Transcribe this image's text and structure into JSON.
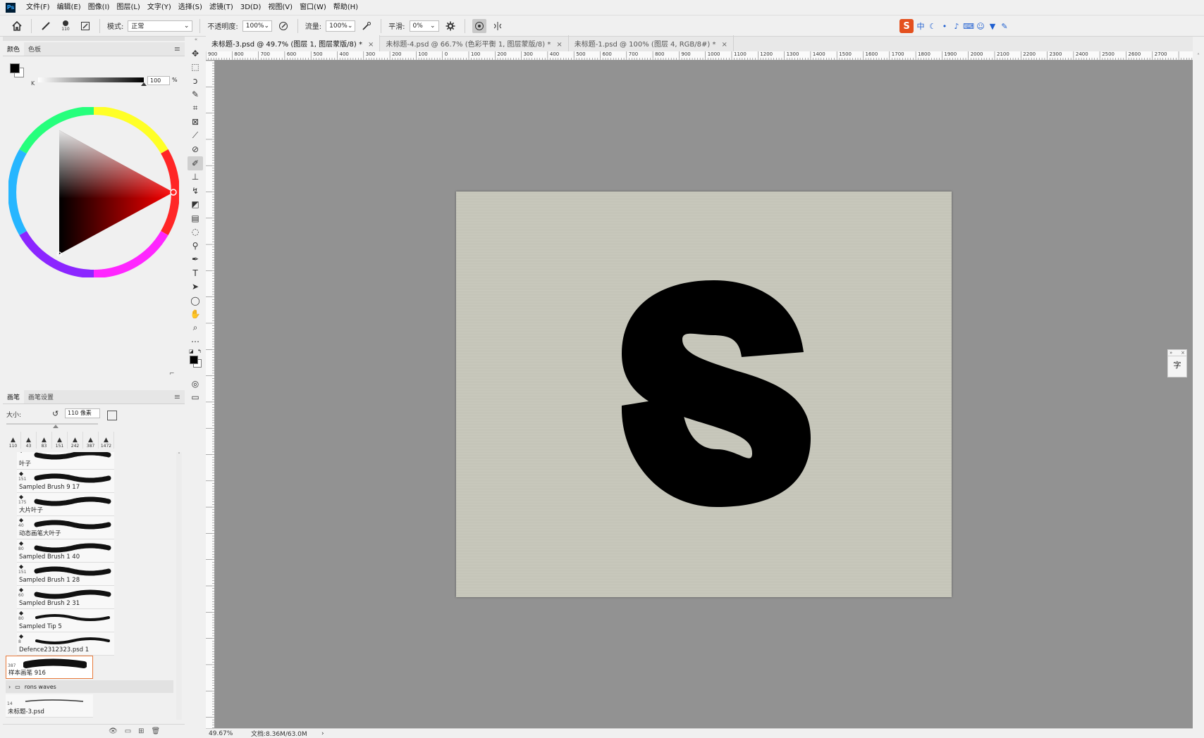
{
  "app": {
    "logo": "Ps"
  },
  "menu": [
    "文件(F)",
    "编辑(E)",
    "图像(I)",
    "图层(L)",
    "文字(Y)",
    "选择(S)",
    "滤镜(T)",
    "3D(D)",
    "视图(V)",
    "窗口(W)",
    "帮助(H)"
  ],
  "options": {
    "brush_size": "110",
    "mode_label": "模式:",
    "mode_value": "正常",
    "opacity_label": "不透明度:",
    "opacity_value": "100%",
    "flow_label": "流量:",
    "flow_value": "100%",
    "smooth_label": "平滑:",
    "smooth_value": "0%"
  },
  "ime": {
    "logo": "S",
    "lang": "中"
  },
  "color_panel": {
    "tabs": [
      "颜色",
      "色板"
    ],
    "slider_label": "K",
    "slider_value": "100",
    "unit": "%"
  },
  "brush_panel": {
    "tabs": [
      "画笔",
      "画笔设置"
    ],
    "size_label": "大小:",
    "size_value": "110 像素",
    "presets": [
      "110",
      "43",
      "83",
      "151",
      "242",
      "387",
      "1472"
    ],
    "brushes": [
      {
        "size": "",
        "name": "叶子"
      },
      {
        "size": "151",
        "name": "Sampled Brush 9 17"
      },
      {
        "size": "175",
        "name": "大片叶子"
      },
      {
        "size": "40",
        "name": "动态画笔大叶子"
      },
      {
        "size": "80",
        "name": "Sampled Brush 1 40"
      },
      {
        "size": "151",
        "name": "Sampled Brush 1 28"
      },
      {
        "size": "60",
        "name": "Sampled Brush 2 31"
      },
      {
        "size": "80",
        "name": "Sampled Tip 5"
      },
      {
        "size": "8",
        "name": "Defence2312323.psd 1"
      }
    ],
    "selected_brush": {
      "size": "387",
      "name": "样本画笔 916"
    },
    "group": "rons waves",
    "last_brush": {
      "size": "14",
      "name": "未标题-3.psd"
    }
  },
  "doc_tabs": [
    {
      "label": "未标题-3.psd @ 49.7% (图层 1, 图层蒙版/8) *",
      "active": true
    },
    {
      "label": "未标题-4.psd @ 66.7% (色彩平衡 1, 图层蒙版/8) *",
      "active": false
    },
    {
      "label": "未标题-1.psd @ 100% (图层 4, RGB/8#) *",
      "active": false
    }
  ],
  "ruler_top": [
    "900",
    "800",
    "700",
    "600",
    "500",
    "400",
    "300",
    "200",
    "100",
    "0",
    "100",
    "200",
    "300",
    "400",
    "500",
    "600",
    "700",
    "800",
    "900",
    "1000",
    "1100",
    "1200",
    "1300",
    "1400",
    "1500",
    "1600",
    "1700",
    "1800",
    "1900",
    "2000",
    "2100",
    "2200",
    "2300",
    "2400",
    "2500",
    "2600",
    "2700"
  ],
  "canvas": {
    "letter": "S",
    "background": "#c5c5b9",
    "workspace": "#929292"
  },
  "status": {
    "zoom": "49.67%",
    "doc": "文档:8.36M/63.0M",
    "arrow": "›"
  },
  "mini_panel": {
    "label": "字",
    "arrows": "»",
    "close": "×"
  }
}
